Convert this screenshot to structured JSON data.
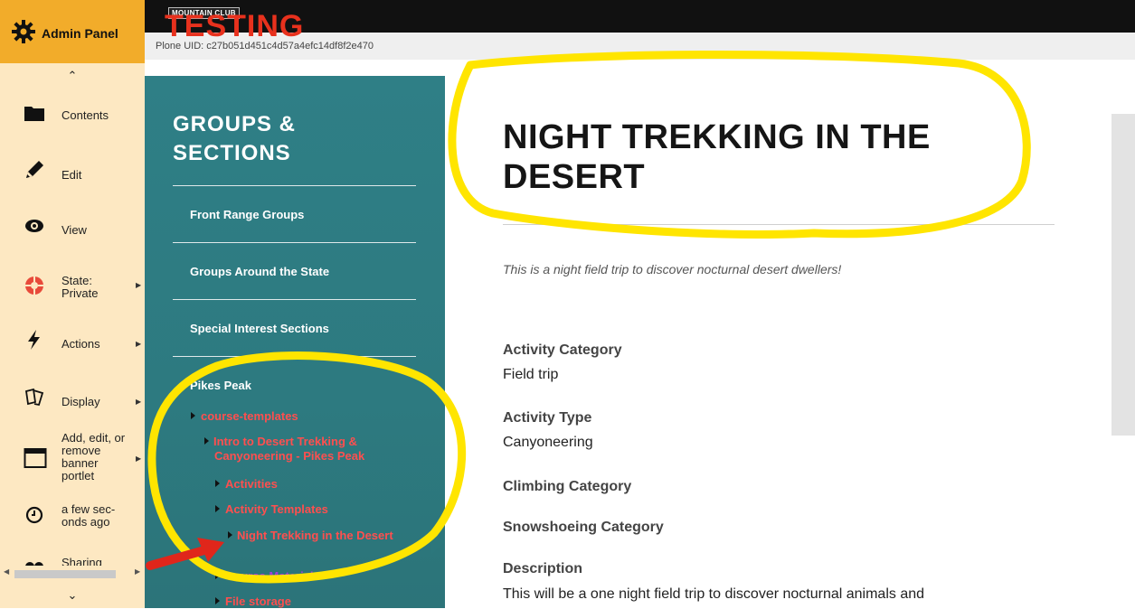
{
  "header": {
    "logo_badge": "MOUNTAIN CLUB",
    "logo_text": "TESTING",
    "uid": "Plone UID: c27b051d451c4d57a4efc14df8f2e470"
  },
  "toolbar": {
    "title": "Admin Panel",
    "items": [
      {
        "label": "Contents",
        "icon": "folder-icon"
      },
      {
        "label": "Edit",
        "icon": "pencil-icon"
      },
      {
        "label": "View",
        "icon": "eye-icon"
      },
      {
        "label": "State: Private",
        "icon": "state-icon"
      },
      {
        "label": "Actions",
        "icon": "lightning-icon"
      },
      {
        "label": "Display",
        "icon": "display-icon"
      },
      {
        "label": "Add, edit, or remove banner portlet",
        "icon": "banner-icon"
      },
      {
        "label": "a few sec-onds ago",
        "icon": "clock-icon"
      },
      {
        "label": "Sharing",
        "icon": "sharing-icon"
      }
    ],
    "accent_color": "#f2ac2a",
    "background_color": "#fde8c2"
  },
  "groups": {
    "title": "GROUPS & SECTIONS",
    "links": [
      "Front Range Groups",
      "Groups Around the State",
      "Special Interest Sections"
    ],
    "current_group": "Pikes Peak",
    "tree": [
      {
        "label": "course-templates",
        "color": "red"
      },
      {
        "label": "Intro to Desert Trekking & Canyoneering - Pikes Peak",
        "color": "red"
      },
      {
        "label": "Activities",
        "color": "red"
      },
      {
        "label": "Activity Templates",
        "color": "red"
      },
      {
        "label": "Night Trekking in the Desert",
        "color": "red"
      },
      {
        "label": "Course Materials",
        "color": "purple"
      },
      {
        "label": "File storage",
        "color": "red"
      }
    ],
    "panel_color": "#2f7f86"
  },
  "main": {
    "title": "NIGHT TREKKING IN THE DESERT",
    "description": "This is a night field trip to discover nocturnal desert dwellers!",
    "fields": [
      {
        "label": "Activity Category",
        "value": "Field trip"
      },
      {
        "label": "Activity Type",
        "value": "Canyoneering"
      },
      {
        "label": "Climbing Category",
        "value": ""
      },
      {
        "label": "Snowshoeing Category",
        "value": ""
      },
      {
        "label": "Description",
        "value": "This will be a one night field trip to discover nocturnal animals and"
      }
    ]
  },
  "annotation_colors": {
    "highlight": "#ffe500",
    "arrow": "#e0261b"
  }
}
